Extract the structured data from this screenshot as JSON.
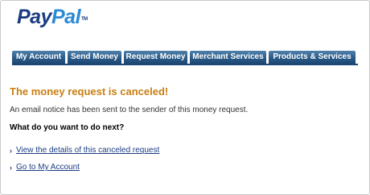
{
  "logo": {
    "part1": "Pay",
    "part2": "Pal",
    "tm": "TM"
  },
  "nav": {
    "tabs": [
      {
        "label": "My Account"
      },
      {
        "label": "Send Money"
      },
      {
        "label": "Request Money"
      },
      {
        "label": "Merchant Services"
      },
      {
        "label": "Products & Services"
      }
    ],
    "color": "#2c5b88"
  },
  "main": {
    "title": "The money request is canceled!",
    "notice": "An email notice has been sent to the sender of this money request.",
    "prompt": "What do you want to do next?",
    "links": [
      {
        "label": "View the details of this canceled request"
      },
      {
        "label": "Go to My Account"
      }
    ],
    "bullet": "›"
  },
  "colors": {
    "title": "#c87e12",
    "link": "#1b3c82"
  }
}
